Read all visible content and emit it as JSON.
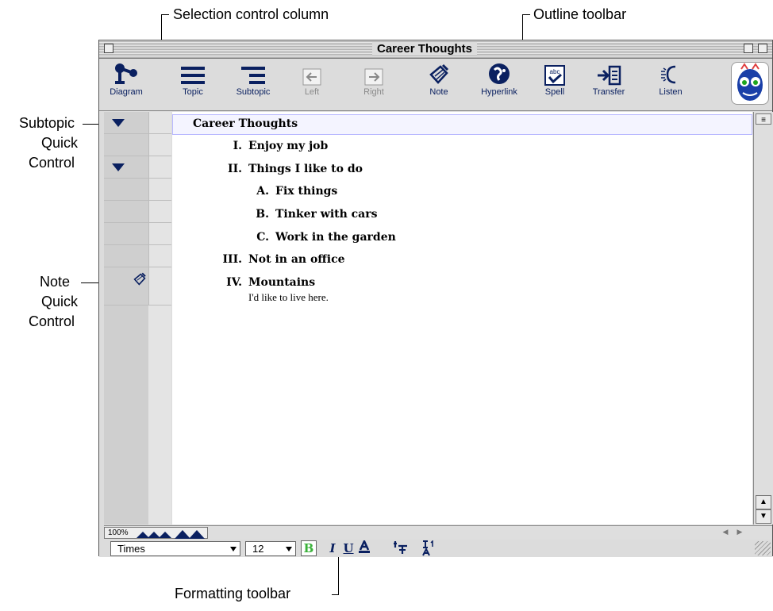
{
  "callouts": {
    "selection_column": "Selection control column",
    "outline_toolbar": "Outline toolbar",
    "subtopic_qc": [
      "Subtopic",
      "Quick",
      "Control"
    ],
    "note_qc": [
      "Note",
      "Quick",
      "Control"
    ],
    "formatting_toolbar": "Formatting toolbar"
  },
  "window": {
    "title": "Career Thoughts"
  },
  "toolbar": {
    "items": [
      {
        "label": "Diagram",
        "icon": "diagram-icon"
      },
      {
        "label": "Topic",
        "icon": "topic-icon"
      },
      {
        "label": "Subtopic",
        "icon": "subtopic-icon"
      },
      {
        "label": "Left",
        "icon": "left-arrow-icon"
      },
      {
        "label": "Right",
        "icon": "right-arrow-icon"
      },
      {
        "label": "Note",
        "icon": "note-icon"
      },
      {
        "label": "Hyperlink",
        "icon": "hyperlink-icon"
      },
      {
        "label": "Spell",
        "icon": "spell-icon"
      },
      {
        "label": "Transfer",
        "icon": "transfer-icon"
      },
      {
        "label": "Listen",
        "icon": "listen-icon"
      }
    ]
  },
  "outline": {
    "main": "Career Thoughts",
    "items": [
      {
        "num": "I.",
        "text": "Enjoy my job"
      },
      {
        "num": "II.",
        "text": "Things I like to do"
      },
      {
        "num": "A.",
        "text": "Fix things"
      },
      {
        "num": "B.",
        "text": "Tinker with cars"
      },
      {
        "num": "C.",
        "text": "Work in the garden"
      },
      {
        "num": "III.",
        "text": "Not in an office"
      },
      {
        "num": "IV.",
        "text": "Mountains"
      }
    ],
    "note": "I'd like to live here."
  },
  "zoom": "100%",
  "format": {
    "font": "Times",
    "size": "12"
  },
  "colors": {
    "accent": "#0a2060",
    "bold_active": "#3ab13a",
    "selection": "#b9b9ff"
  }
}
